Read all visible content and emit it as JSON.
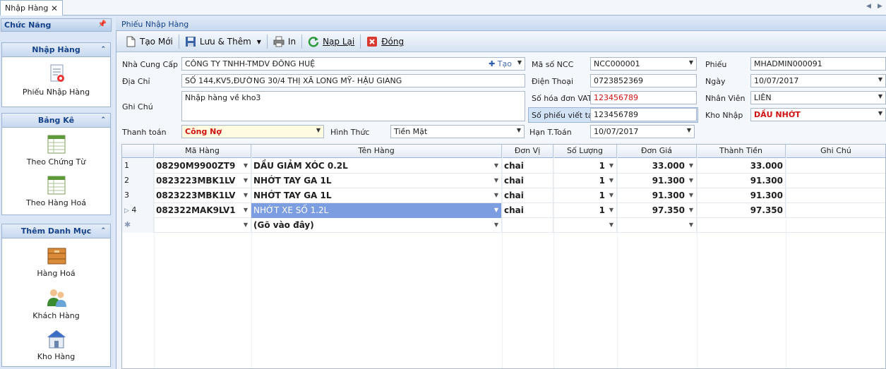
{
  "tab": {
    "title": "Nhập Hàng",
    "close": "✕"
  },
  "left_panel": {
    "header": "Chức Năng",
    "groups": [
      {
        "title": "Nhập Hàng",
        "items": [
          "Phiếu Nhập Hàng"
        ]
      },
      {
        "title": "Bảng Kê",
        "items": [
          "Theo Chứng Từ",
          "Theo Hàng Hoá"
        ]
      },
      {
        "title": "Thêm Danh Mục",
        "items": [
          "Hàng Hoá",
          "Khách Hàng",
          "Kho Hàng"
        ]
      }
    ]
  },
  "panel_title": "Phiếu Nhập Hàng",
  "toolbar": {
    "new": "Tạo Mới",
    "save_add": "Lưu & Thêm",
    "print": "In",
    "reload": "Nạp Lại",
    "close": "Đóng"
  },
  "form": {
    "supplier_label": "Nhà Cung Cấp",
    "supplier": "CÔNG TY TNHH-TMDV ĐÔNG HUỆ",
    "create_label": "Tạo",
    "address_label": "Địa Chỉ",
    "address": "SỐ 144,KV5,ĐƯỜNG 30/4 THỊ XÃ LONG MỸ- HẬU GIANG",
    "note_label": "Ghi Chú",
    "note": "Nhập hàng về kho3",
    "payment_label": "Thanh toán",
    "payment": "Công Nợ",
    "method_label": "Hình Thức",
    "method": "Tiền Mặt",
    "due_label": "Hạn T.Toán",
    "due": "10/07/2017",
    "supplier_code_label": "Mã số NCC",
    "supplier_code": "NCC000001",
    "phone_label": "Điện Thoại",
    "phone": "0723852369",
    "vat_label": "Số hóa đơn VAT",
    "vat": "123456789",
    "handwritten_label": "Số phiếu viết tay",
    "handwritten": "123456789",
    "voucher_label": "Phiếu",
    "voucher": "MHADMIN000091",
    "date_label": "Ngày",
    "date": "10/07/2017",
    "staff_label": "Nhân Viên",
    "staff": "LIÊN",
    "warehouse_label": "Kho Nhập",
    "warehouse": "DẦU NHỚT"
  },
  "grid": {
    "columns": [
      "Mã Hàng",
      "Tên Hàng",
      "Đơn Vị",
      "Số Lượng",
      "Đơn Giá",
      "Thành Tiền",
      "Ghi Chú"
    ],
    "rows": [
      {
        "no": "1",
        "code": "08290M9900ZT9",
        "name": "DẦU GIẢM XÓC 0.2L",
        "unit": "chai",
        "qty": "1",
        "price": "33.000",
        "total": "33.000"
      },
      {
        "no": "2",
        "code": "0823223MBK1LV",
        "name": "NHỚT TAY GA 1L",
        "unit": "chai",
        "qty": "1",
        "price": "91.300",
        "total": "91.300"
      },
      {
        "no": "3",
        "code": "0823223MBK1LV",
        "name": "NHỚT TAY GA 1L",
        "unit": "chai",
        "qty": "1",
        "price": "91.300",
        "total": "91.300"
      },
      {
        "no": "4",
        "code": "082322MAK9LV1",
        "name": "NHỚT XE SỐ 1.2L",
        "unit": "chai",
        "qty": "1",
        "price": "97.350",
        "total": "97.350"
      }
    ],
    "new_row_text": "(Gõ vào đây)"
  }
}
